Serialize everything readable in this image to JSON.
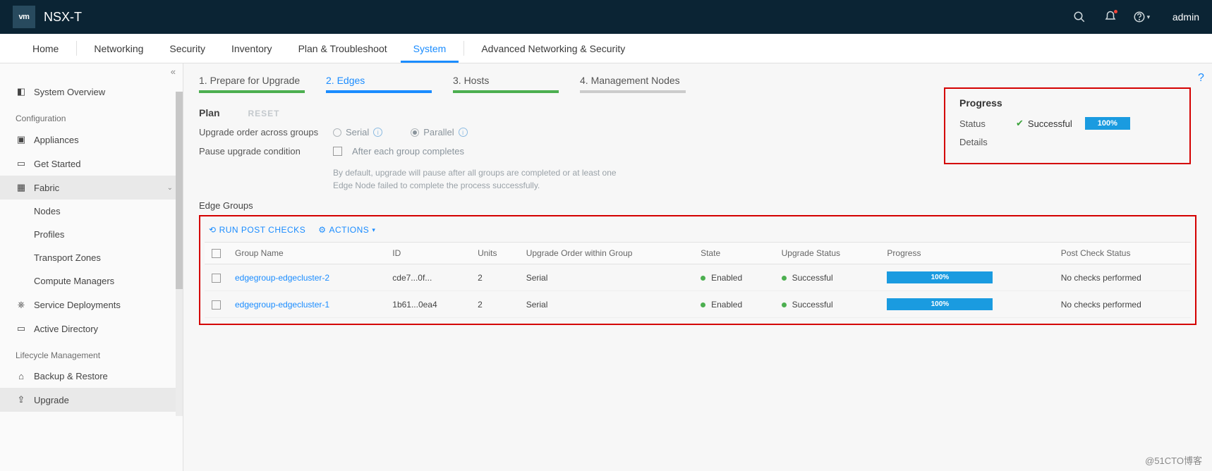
{
  "brand": {
    "logo": "vm",
    "product": "NSX-T"
  },
  "topbar": {
    "user": "admin"
  },
  "nav": {
    "home": "Home",
    "networking": "Networking",
    "security": "Security",
    "inventory": "Inventory",
    "plan": "Plan & Troubleshoot",
    "system": "System",
    "advanced": "Advanced Networking & Security"
  },
  "sidebar": {
    "overview": "System Overview",
    "section_config": "Configuration",
    "appliances": "Appliances",
    "get_started": "Get Started",
    "fabric": "Fabric",
    "nodes": "Nodes",
    "profiles": "Profiles",
    "tzones": "Transport Zones",
    "compute": "Compute Managers",
    "svc": "Service Deployments",
    "ad": "Active Directory",
    "section_lifecycle": "Lifecycle Management",
    "backup": "Backup & Restore",
    "upgrade": "Upgrade"
  },
  "wizard": {
    "s1": "1. Prepare for Upgrade",
    "s2": "2. Edges",
    "s3": "3. Hosts",
    "s4": "4. Management Nodes"
  },
  "plan": {
    "title": "Plan",
    "reset": "RESET",
    "order_label": "Upgrade order across groups",
    "serial": "Serial",
    "parallel": "Parallel",
    "pause_label": "Pause upgrade condition",
    "pause_opt": "After each group completes",
    "note": "By default, upgrade will pause after all groups are completed or at least one Edge Node failed to complete the process successfully."
  },
  "progress": {
    "title": "Progress",
    "status_label": "Status",
    "status_value": "Successful",
    "percent": "100%",
    "details_label": "Details"
  },
  "groups": {
    "title": "Edge Groups",
    "run_checks": "RUN POST CHECKS",
    "actions": "ACTIONS",
    "cols": {
      "name": "Group Name",
      "id": "ID",
      "units": "Units",
      "order": "Upgrade Order within Group",
      "state": "State",
      "ustatus": "Upgrade Status",
      "progress": "Progress",
      "post": "Post Check Status"
    },
    "rows": [
      {
        "name": "edgegroup-edgecluster-2",
        "id": "cde7...0f...",
        "units": "2",
        "order": "Serial",
        "state": "Enabled",
        "ustatus": "Successful",
        "progress": "100%",
        "post": "No checks performed"
      },
      {
        "name": "edgegroup-edgecluster-1",
        "id": "1b61...0ea4",
        "units": "2",
        "order": "Serial",
        "state": "Enabled",
        "ustatus": "Successful",
        "progress": "100%",
        "post": "No checks performed"
      }
    ]
  },
  "watermark": "@51CTO博客"
}
